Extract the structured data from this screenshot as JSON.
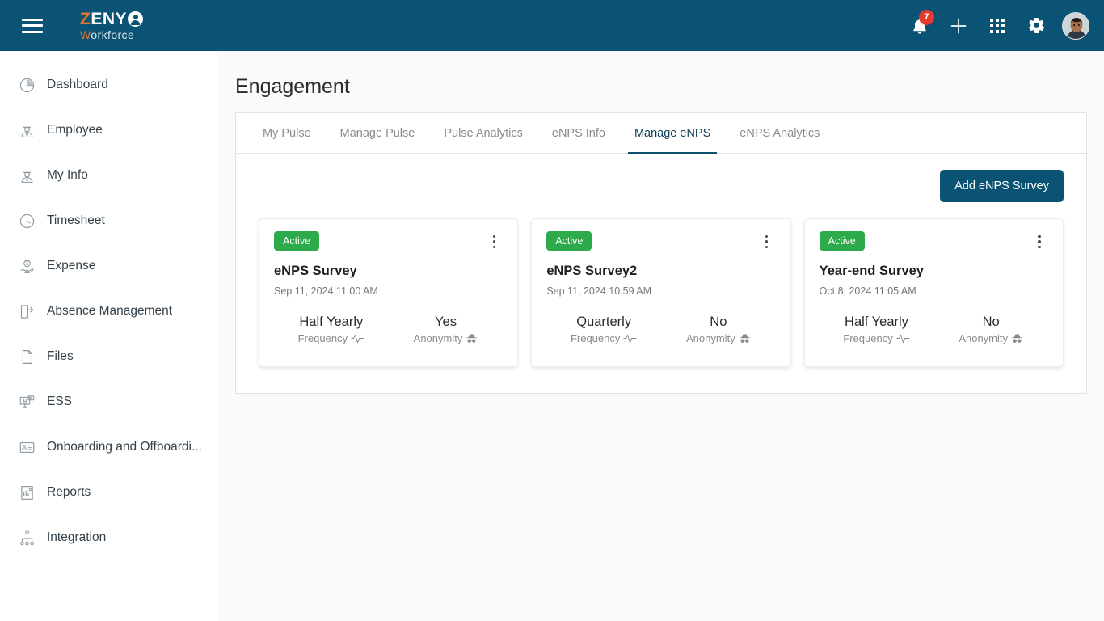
{
  "topbar": {
    "menu_icon": "hamburger-menu-icon",
    "logo": {
      "text_primary": "Z",
      "text_secondary": "ENY",
      "sub_primary": "W",
      "sub_secondary": "orkforce"
    },
    "notifications": {
      "icon": "bell-icon",
      "count": "7"
    },
    "add": {
      "icon": "plus-icon"
    },
    "apps": {
      "icon": "grid-apps-icon"
    },
    "settings": {
      "icon": "gear-icon"
    },
    "profile": {
      "icon": "user-avatar"
    }
  },
  "sidebar": {
    "items": [
      {
        "label": "Dashboard",
        "icon": "pie-chart-icon"
      },
      {
        "label": "Employee",
        "icon": "employee-icon"
      },
      {
        "label": "My Info",
        "icon": "employee-icon"
      },
      {
        "label": "Timesheet",
        "icon": "clock-icon"
      },
      {
        "label": "Expense",
        "icon": "money-hand-icon"
      },
      {
        "label": "Absence Management",
        "icon": "door-exit-icon"
      },
      {
        "label": "Files",
        "icon": "document-icon"
      },
      {
        "label": "ESS",
        "icon": "monitor-user-icon"
      },
      {
        "label": "Onboarding and Offboardi...",
        "icon": "id-card-icon"
      },
      {
        "label": "Reports",
        "icon": "report-chart-icon"
      },
      {
        "label": "Integration",
        "icon": "sitemap-icon"
      }
    ]
  },
  "main": {
    "page_title": "Engagement",
    "tabs": [
      {
        "label": "My Pulse",
        "active": false
      },
      {
        "label": "Manage Pulse",
        "active": false
      },
      {
        "label": "Pulse Analytics",
        "active": false
      },
      {
        "label": "eNPS Info",
        "active": false
      },
      {
        "label": "Manage eNPS",
        "active": true
      },
      {
        "label": "eNPS Analytics",
        "active": false
      }
    ],
    "add_button_label": "Add eNPS Survey",
    "frequency_label": "Frequency",
    "anonymity_label": "Anonymity",
    "cards": [
      {
        "status": "Active",
        "title": "eNPS Survey",
        "date": "Sep 11, 2024  11:00 AM",
        "frequency": "Half Yearly",
        "anonymity": "Yes"
      },
      {
        "status": "Active",
        "title": "eNPS Survey2",
        "date": "Sep 11, 2024  10:59 AM",
        "frequency": "Quarterly",
        "anonymity": "No"
      },
      {
        "status": "Active",
        "title": "Year-end Survey",
        "date": "Oct 8, 2024  11:05 AM",
        "frequency": "Half Yearly",
        "anonymity": "No"
      }
    ]
  },
  "colors": {
    "header_bg": "#0a5375",
    "accent_orange": "#e8762c",
    "status_green": "#2daa4a",
    "badge_red": "#e8392c",
    "tab_active": "#0d4f6e"
  }
}
